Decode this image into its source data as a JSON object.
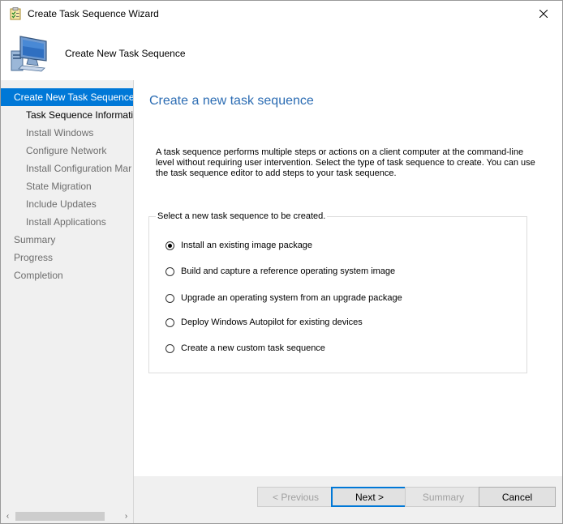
{
  "window": {
    "title": "Create Task Sequence Wizard",
    "close_glyph": "✕"
  },
  "header": {
    "title": "Create New Task Sequence"
  },
  "nav": {
    "items": [
      {
        "label": "Create New Task Sequence",
        "level": 0,
        "state": "active"
      },
      {
        "label": "Task Sequence Informatic",
        "level": 1,
        "state": "current"
      },
      {
        "label": "Install Windows",
        "level": 1,
        "state": "pending"
      },
      {
        "label": "Configure Network",
        "level": 1,
        "state": "pending"
      },
      {
        "label": "Install Configuration Mar",
        "level": 1,
        "state": "pending"
      },
      {
        "label": "State Migration",
        "level": 1,
        "state": "pending"
      },
      {
        "label": "Include Updates",
        "level": 1,
        "state": "pending"
      },
      {
        "label": "Install Applications",
        "level": 1,
        "state": "pending"
      },
      {
        "label": "Summary",
        "level": 0,
        "state": "pending"
      },
      {
        "label": "Progress",
        "level": 0,
        "state": "pending"
      },
      {
        "label": "Completion",
        "level": 0,
        "state": "pending"
      }
    ],
    "scroll_left": "‹",
    "scroll_right": "›"
  },
  "main": {
    "title": "Create a new task sequence",
    "description": "A task sequence performs multiple steps or actions on a client computer at the command-line level without requiring user intervention. Select the type of task sequence to create. You can use the task sequence editor to add steps to your task sequence.",
    "group_label": "Select a new task sequence to be created.",
    "options": [
      {
        "label": "Install an existing image package",
        "checked": true
      },
      {
        "label": "Build and capture a reference operating system image",
        "checked": false
      },
      {
        "label": "Upgrade an operating system from an upgrade package",
        "checked": false
      },
      {
        "label": "Deploy Windows Autopilot for existing devices",
        "checked": false
      },
      {
        "label": "Create a new custom task sequence",
        "checked": false
      }
    ]
  },
  "buttons": {
    "previous": "< Previous",
    "next": "Next >",
    "summary": "Summary",
    "cancel": "Cancel"
  },
  "colors": {
    "accent": "#0078d7",
    "title_blue": "#2b6cb3"
  }
}
